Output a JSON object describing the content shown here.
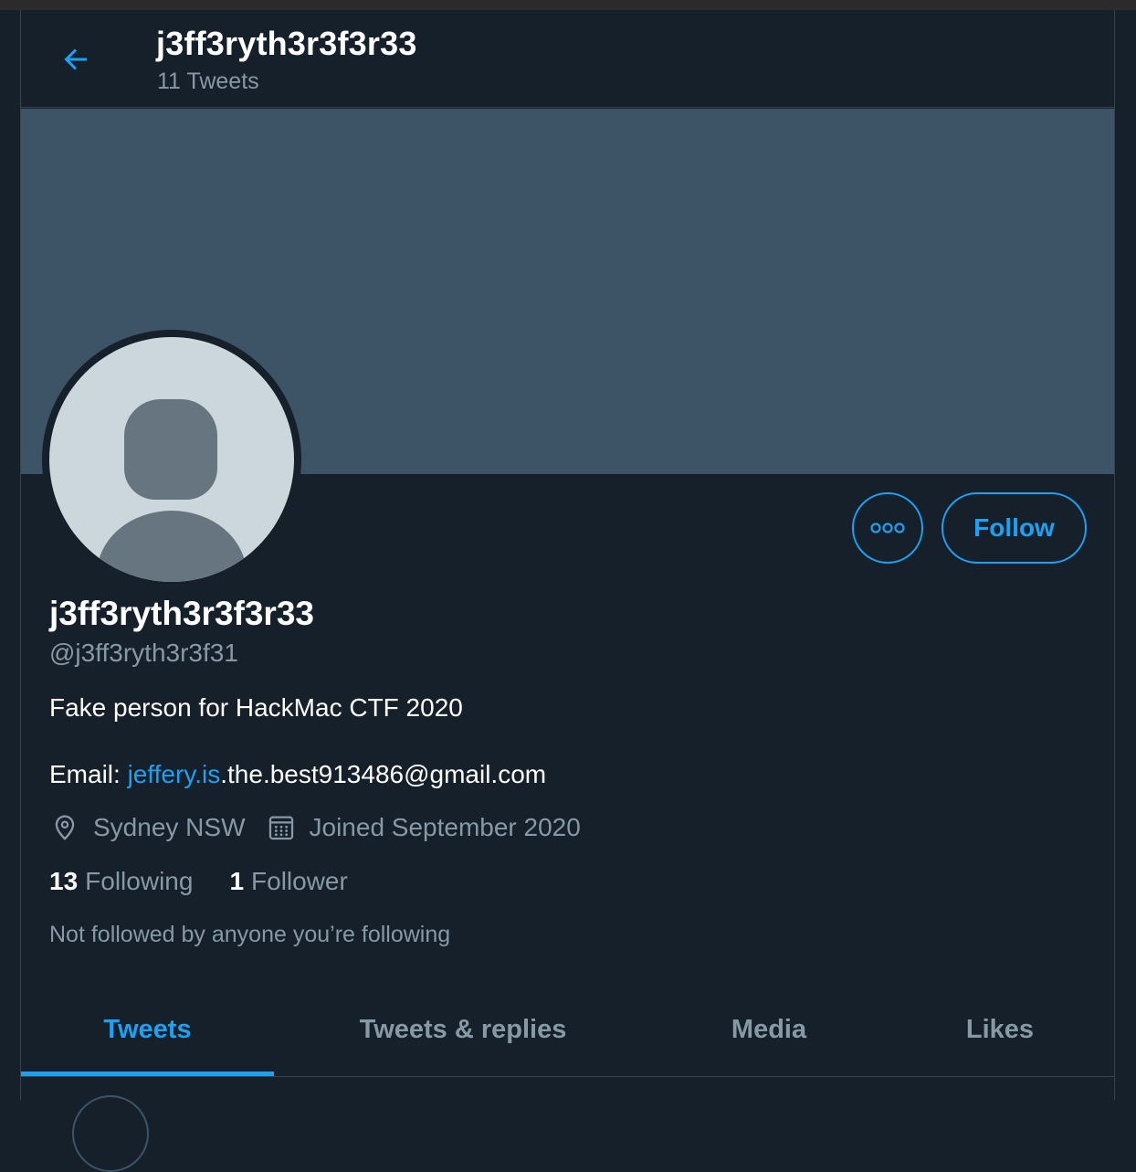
{
  "header": {
    "title": "j3ff3ryth3r3f3r33",
    "subtitle": "11 Tweets"
  },
  "profile": {
    "display_name": "j3ff3ryth3r3f3r33",
    "handle": "@j3ff3ryth3r3f31",
    "bio": "Fake person for HackMac CTF 2020",
    "email_label": "Email: ",
    "email_link": "jeffery.is",
    "email_rest": ".the.best913486@gmail.com",
    "location": "Sydney NSW",
    "joined": "Joined September 2020"
  },
  "stats": {
    "following_count": "13",
    "following_label": "Following",
    "followers_count": "1",
    "followers_label": "Follower"
  },
  "social_context": "Not followed by anyone you’re following",
  "actions": {
    "follow_label": "Follow"
  },
  "tabs": [
    {
      "label": "Tweets",
      "active": true
    },
    {
      "label": "Tweets & replies",
      "active": false
    },
    {
      "label": "Media",
      "active": false
    },
    {
      "label": "Likes",
      "active": false
    }
  ],
  "colors": {
    "background": "#15202b",
    "banner": "#3d5466",
    "accent": "#1da1f2",
    "secondary_text": "#8899a6",
    "border": "#38444d"
  },
  "icons": [
    "back-arrow-icon",
    "more-options-icon",
    "location-pin-icon",
    "calendar-icon"
  ]
}
